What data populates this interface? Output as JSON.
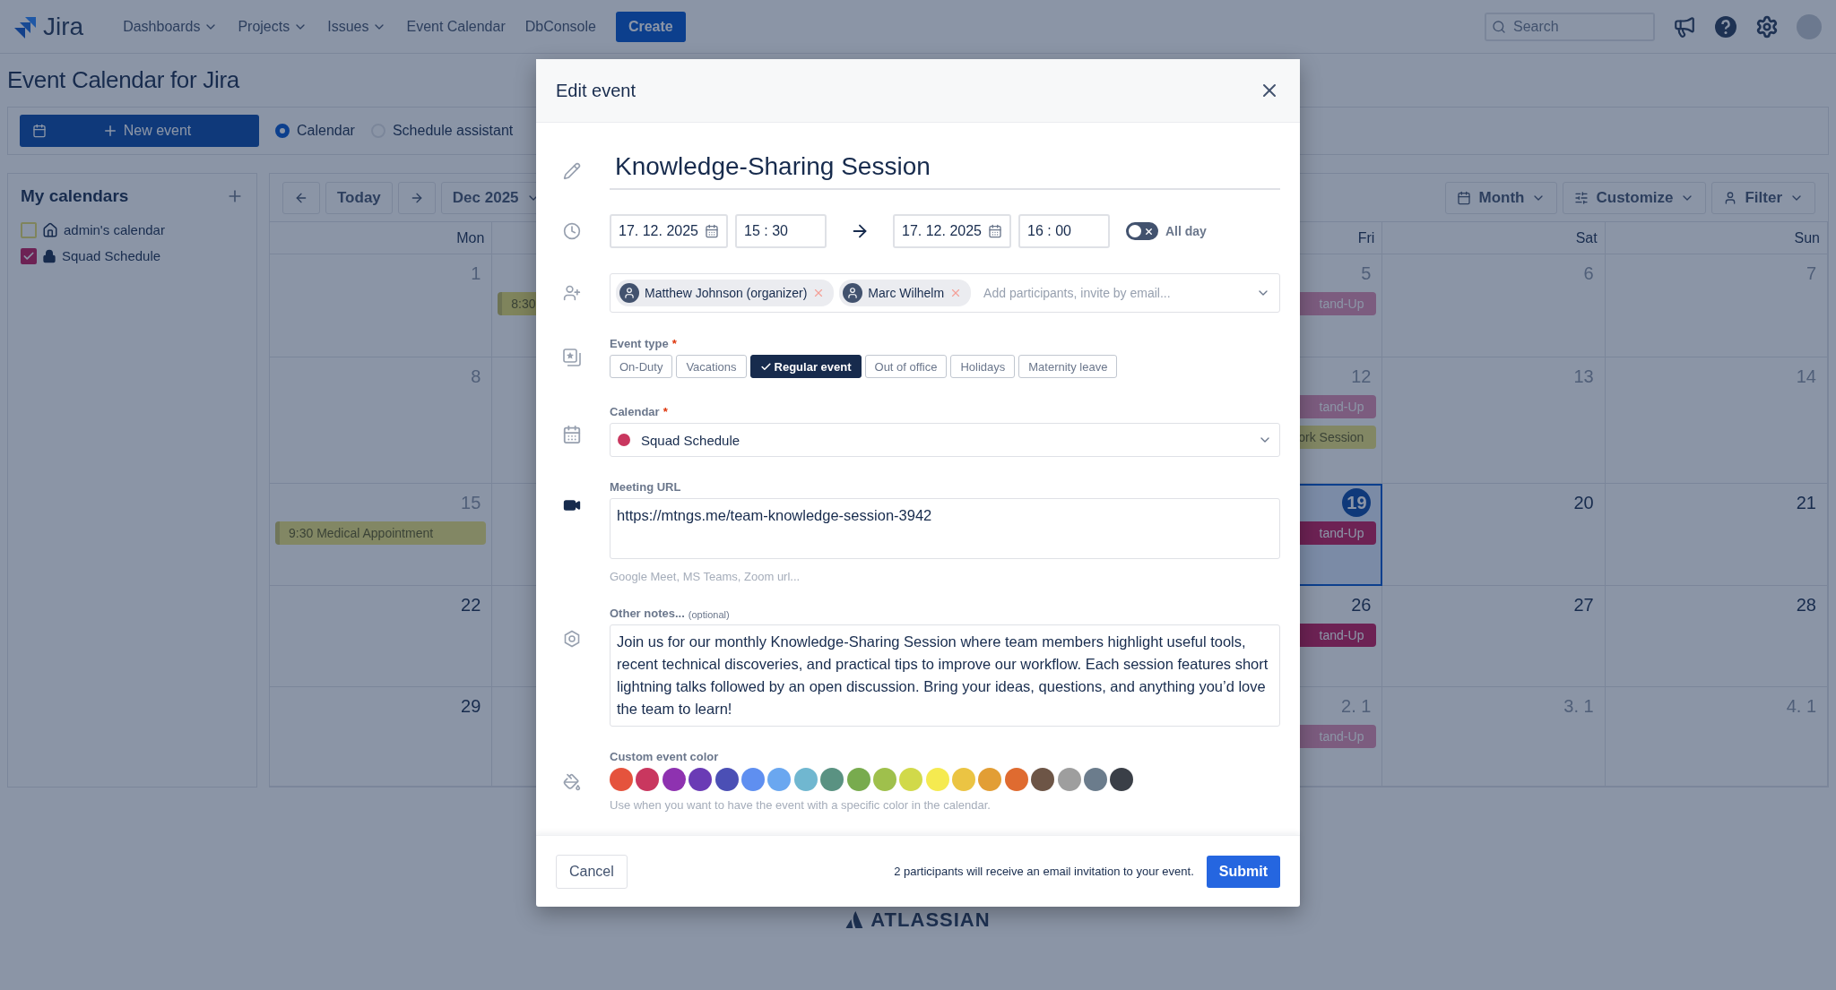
{
  "nav": {
    "logo": "Jira",
    "items": [
      {
        "label": "Dashboards",
        "dropdown": true
      },
      {
        "label": "Projects",
        "dropdown": true
      },
      {
        "label": "Issues",
        "dropdown": true
      },
      {
        "label": "Event Calendar",
        "dropdown": false
      },
      {
        "label": "DbConsole",
        "dropdown": false
      }
    ],
    "create": "Create",
    "search": {
      "placeholder": "Search"
    }
  },
  "page_title": "Event Calendar for Jira",
  "toolbar": {
    "new_event": "New event",
    "views": [
      {
        "label": "Calendar",
        "selected": true
      },
      {
        "label": "Schedule assistant",
        "selected": false
      }
    ]
  },
  "sidebar": {
    "title": "My calendars",
    "calendars": [
      {
        "name": "admin's calendar",
        "checked": false,
        "kind": "home"
      },
      {
        "name": "Squad Schedule",
        "checked": true,
        "kind": "lock"
      }
    ]
  },
  "calendar": {
    "today": "Today",
    "month": "Dec 2025",
    "views": [
      {
        "label": "Month",
        "kind": "calendar"
      },
      {
        "label": "Customize",
        "kind": "sliders"
      },
      {
        "label": "Filter",
        "kind": "user"
      }
    ],
    "weekdays_left": [
      {
        "label": "Mon"
      }
    ],
    "weekdays_right": [
      {
        "label": "Fri"
      },
      {
        "label": "Sat"
      },
      {
        "label": "Sun"
      }
    ],
    "weeks": [
      {
        "cells": [
          {
            "day": "1",
            "muted": true,
            "today": false
          },
          {
            "events": [
              {
                "title": "8:30",
                "kind": "home"
              }
            ]
          },
          {},
          {},
          {
            "day": "5",
            "muted": true,
            "today": false,
            "events": [
              {
                "title": "tand-Up",
                "kind": "lock"
              }
            ]
          },
          {
            "day": "6",
            "muted": true,
            "today": false
          },
          {
            "day": "7",
            "muted": true,
            "today": false
          }
        ]
      },
      {
        "cells": [
          {
            "day": "8",
            "muted": true,
            "today": false
          },
          {},
          {},
          {},
          {
            "day": "12",
            "muted": true,
            "today": false,
            "events": [
              {
                "title": "tand-Up",
                "kind": "lock"
              },
              {
                "title": "ork Session",
                "kind": "home"
              }
            ]
          },
          {
            "day": "13",
            "muted": true,
            "today": false
          },
          {
            "day": "14",
            "muted": true,
            "today": false
          }
        ]
      },
      {
        "cells": [
          {
            "day": "15",
            "muted": true,
            "today": false,
            "events": [
              {
                "title": "9:30 Medical Appointment",
                "kind": "home"
              }
            ]
          },
          {},
          {},
          {},
          {
            "day": "19",
            "today": true,
            "events": [
              {
                "title": "tand-Up",
                "kind": "lock"
              }
            ]
          },
          {
            "day": "20",
            "muted": false,
            "today": false
          },
          {
            "day": "21",
            "muted": false,
            "today": false
          }
        ]
      },
      {
        "cells": [
          {
            "day": "22",
            "muted": false,
            "today": false
          },
          {},
          {},
          {},
          {
            "day": "26",
            "muted": false,
            "today": false,
            "events": [
              {
                "title": "tand-Up",
                "kind": "lock"
              }
            ]
          },
          {
            "day": "27",
            "muted": false,
            "today": false
          },
          {
            "day": "28",
            "muted": false,
            "today": false
          }
        ]
      },
      {
        "cells": [
          {
            "day": "29",
            "muted": false,
            "today": false
          },
          {},
          {},
          {},
          {
            "day": "2. 1",
            "muted": true,
            "today": false,
            "events": [
              {
                "title": "tand-Up",
                "kind": "lock"
              }
            ]
          },
          {
            "day": "3. 1",
            "muted": true,
            "today": false
          },
          {
            "day": "4. 1",
            "muted": true,
            "today": false
          }
        ]
      }
    ]
  },
  "footer_logo": "ATLASSIAN",
  "modal": {
    "title": "Edit event",
    "event_title": "Knowledge-Sharing Session",
    "start_date": "17. 12. 2025",
    "start_time": "15 : 30",
    "end_date": "17. 12. 2025",
    "end_time": "16 : 00",
    "all_day": {
      "label": "All day",
      "on": false
    },
    "participants": {
      "chips": [
        {
          "name": "Matthew Johnson (organizer)"
        },
        {
          "name": "Marc Wilhelm"
        }
      ],
      "placeholder": "Add participants, invite by email..."
    },
    "event_type": {
      "label": "Event type",
      "required_mark": "*",
      "options": [
        {
          "label": "On-Duty",
          "selected": false
        },
        {
          "label": "Vacations",
          "selected": false
        },
        {
          "label": "Regular event",
          "selected": true
        },
        {
          "label": "Out of office",
          "selected": false
        },
        {
          "label": "Holidays",
          "selected": false
        },
        {
          "label": "Maternity leave",
          "selected": false
        }
      ]
    },
    "calendar": {
      "label": "Calendar",
      "required_mark": "*",
      "value": "Squad Schedule",
      "color": "#c9375f"
    },
    "meeting_url": {
      "label": "Meeting URL",
      "value": "https://mtngs.me/team-knowledge-session-3942",
      "hint": "Google Meet, MS Teams, Zoom url..."
    },
    "notes": {
      "label": "Other notes...",
      "optional": "(optional)",
      "value": "Join us for our monthly Knowledge-Sharing Session where team members highlight useful tools, recent technical discoveries, and practical tips to improve our workflow. Each session features short lightning talks followed by an open discussion. Bring your ideas, questions, and anything you’d love the team to learn!"
    },
    "custom_color": {
      "label": "Custom event color",
      "swatches": [
        {
          "color": "#e5533d"
        },
        {
          "color": "#c9375f"
        },
        {
          "color": "#8e32b0"
        },
        {
          "color": "#6a3bb5"
        },
        {
          "color": "#4b4fb5"
        },
        {
          "color": "#5f8ff0"
        },
        {
          "color": "#6aa7f0"
        },
        {
          "color": "#70b7d0"
        },
        {
          "color": "#5a9282"
        },
        {
          "color": "#78ab4e"
        },
        {
          "color": "#9fc04c"
        },
        {
          "color": "#d1d94a"
        },
        {
          "color": "#f5ea50"
        },
        {
          "color": "#ebc443"
        },
        {
          "color": "#e29e35"
        },
        {
          "color": "#df6b30"
        },
        {
          "color": "#6d5546"
        },
        {
          "color": "#9e9e9e"
        },
        {
          "color": "#6b7c8c"
        },
        {
          "color": "#3a3f47"
        }
      ],
      "hint": "Use when you want to have the event with a specific color in the calendar."
    },
    "footer": {
      "cancel": "Cancel",
      "message": "2 participants will receive an email invitation to your event.",
      "submit": "Submit"
    }
  }
}
